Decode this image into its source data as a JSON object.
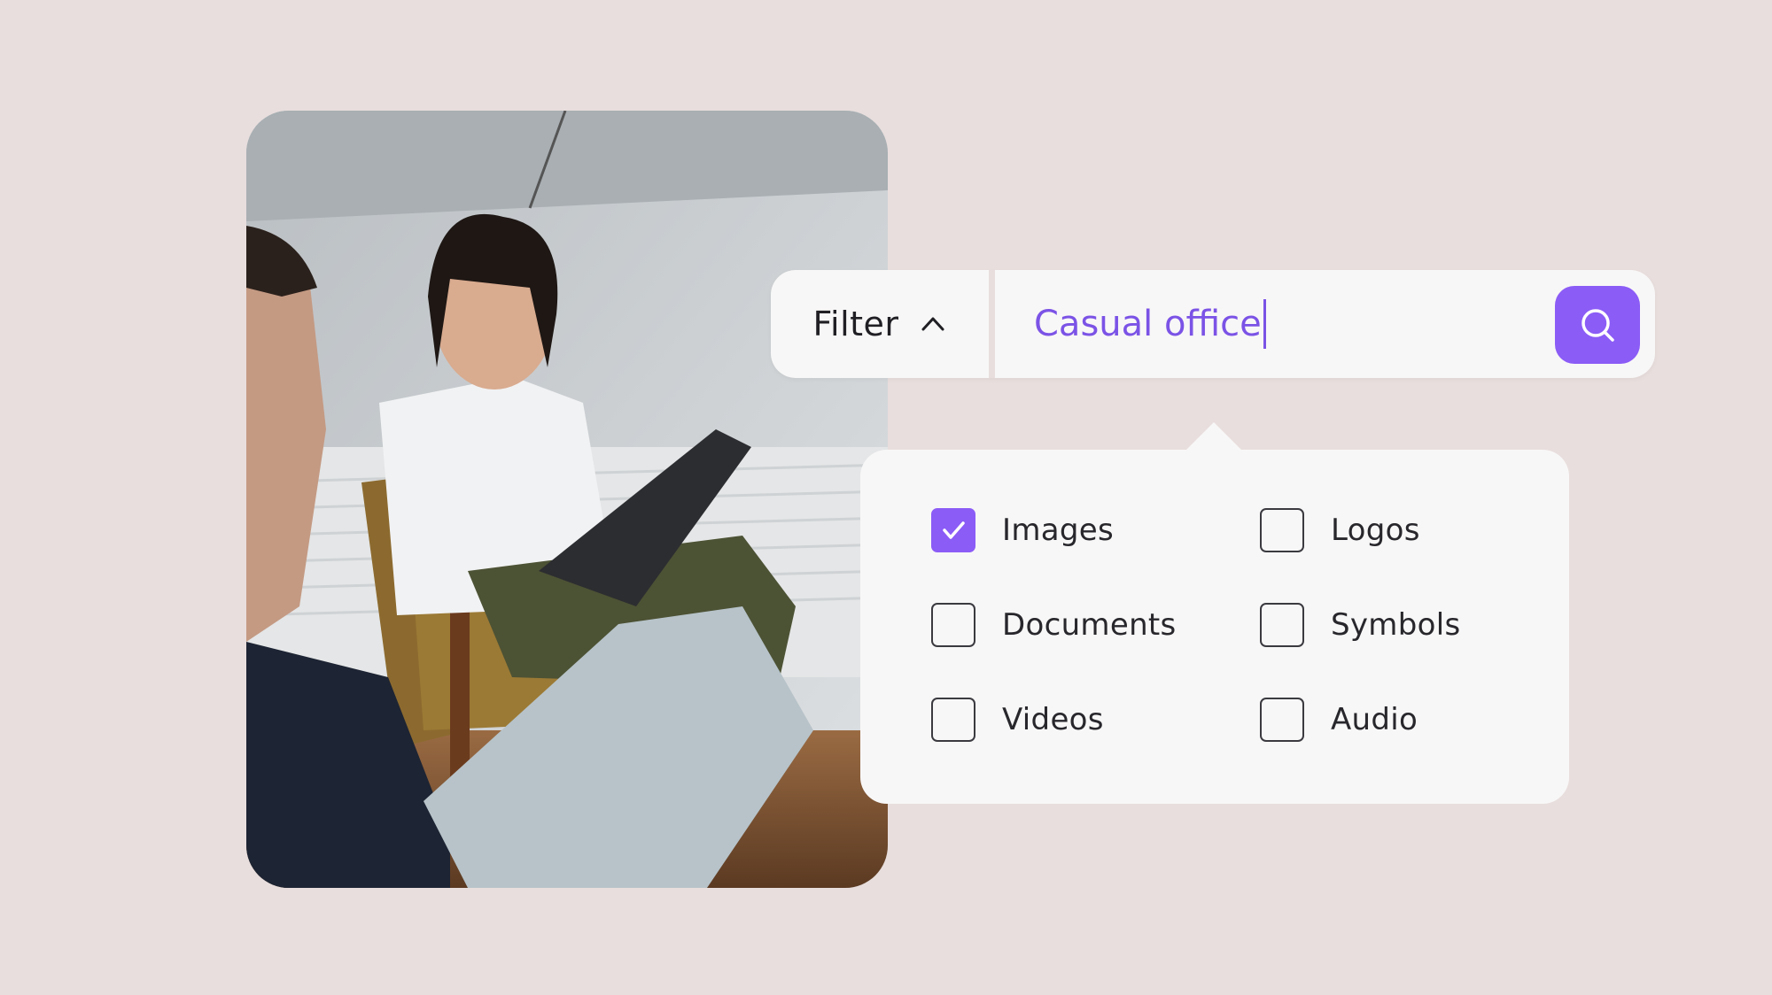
{
  "colors": {
    "background": "#e8dedd",
    "accent": "#8b5cf6",
    "query_text": "#7b53e6",
    "surface": "#f8f7f7"
  },
  "photo": {
    "alt": "Two people in a casual office, one smiling with a laptop"
  },
  "search": {
    "filter_label": "Filter",
    "filter_icon": "chevron-up-icon",
    "query": "Casual office",
    "button_icon": "search-icon"
  },
  "filters": {
    "options": [
      {
        "label": "Images",
        "checked": true
      },
      {
        "label": "Logos",
        "checked": false
      },
      {
        "label": "Documents",
        "checked": false
      },
      {
        "label": "Symbols",
        "checked": false
      },
      {
        "label": "Videos",
        "checked": false
      },
      {
        "label": "Audio",
        "checked": false
      }
    ]
  }
}
